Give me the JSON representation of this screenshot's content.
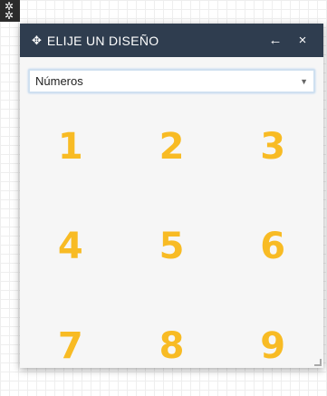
{
  "corner_icon": "gear-icon",
  "dialog": {
    "title_icon": "move-arrows-icon",
    "title": "ELIJE UN DISEÑO",
    "back_symbol": "←",
    "close_symbol": "×"
  },
  "select": {
    "value": "Números"
  },
  "designs": [
    "1",
    "2",
    "3",
    "4",
    "5",
    "6",
    "7",
    "8",
    "9"
  ],
  "colors": {
    "titlebar": "#2f3d4f",
    "number": "#f8bb24"
  }
}
